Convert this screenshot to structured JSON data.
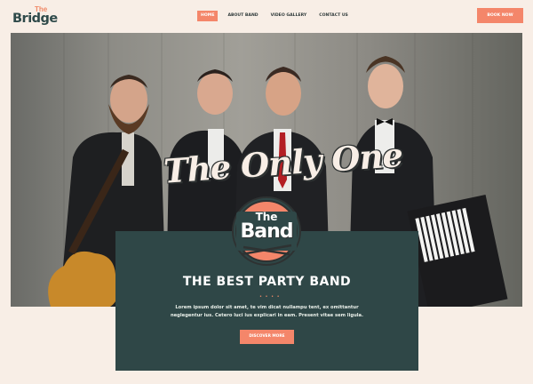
{
  "header": {
    "logo_small": "The",
    "logo_main": "Bridge",
    "nav": [
      "Home",
      "About Band",
      "Video Gallery",
      "Contact Us"
    ],
    "book_label": "Book Now"
  },
  "hero": {
    "script_title": "The Only One"
  },
  "badge": {
    "small": "The",
    "main": "Band"
  },
  "card": {
    "title": "THE BEST PARTY BAND",
    "text": "Lorem ipsum dolor sit amet, te vim dicat nullampu tent, ex omittantur neglegentur ius. Cetero luci ius explicari in eam. Present vitae sem ligula.",
    "button_label": "Discover More"
  },
  "colors": {
    "accent": "#f4866a",
    "dark_teal": "#2f4747",
    "background": "#f8eee6"
  }
}
